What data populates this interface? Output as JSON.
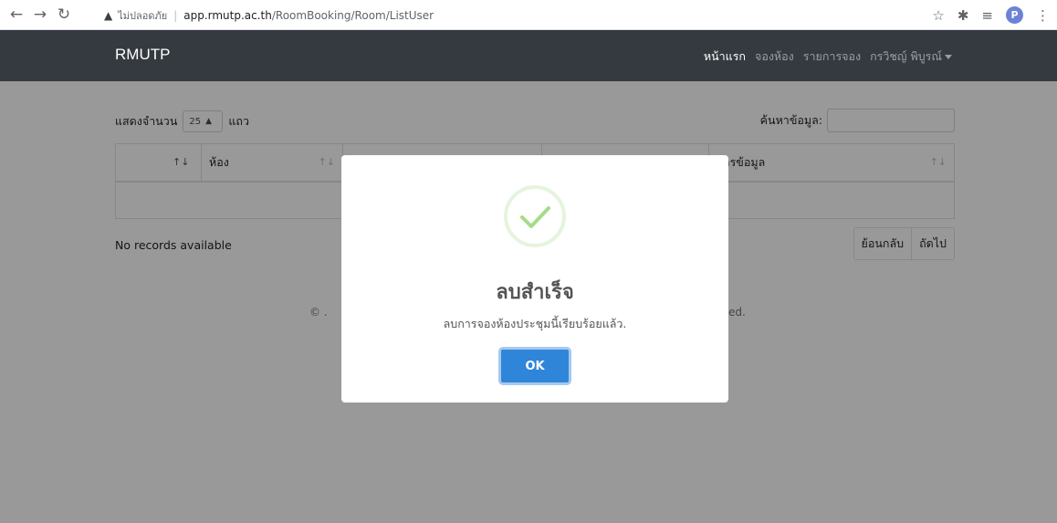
{
  "browser": {
    "insecure_label": "ไม่ปลอดภัย",
    "url_host": "app.rmutp.ac.th",
    "url_path": "/RoomBooking/Room/ListUser",
    "profile_initial": "P"
  },
  "navbar": {
    "brand": "RMUTP",
    "links": [
      {
        "label": "หน้าแรก",
        "active": true
      },
      {
        "label": "จองห้อง",
        "active": false
      },
      {
        "label": "รายการจอง",
        "active": false
      },
      {
        "label": "กรวิชญ์ พิบูรณ์",
        "active": false
      }
    ]
  },
  "table_controls": {
    "length_prefix": "แสดงจำนวน",
    "length_value": "25",
    "length_suffix": "แถว",
    "search_label": "ค้นหาข้อมูล:"
  },
  "table": {
    "headers": [
      "",
      "ห้อง",
      "",
      "",
      "การข้อมูล"
    ]
  },
  "no_records": "No records available",
  "pager": {
    "prev": "ย้อนกลับ",
    "next": "ถัดไป"
  },
  "footer": {
    "left_fragment": "© .",
    "right_fragment": "ed."
  },
  "modal": {
    "title": "ลบสำเร็จ",
    "text": "ลบการจองห้องประชุมนี้เรียบร้อยแล้ว.",
    "ok_label": "OK",
    "icon": "success-check-icon",
    "accent_color": "#a5dc86",
    "button_color": "#2f86d9"
  }
}
